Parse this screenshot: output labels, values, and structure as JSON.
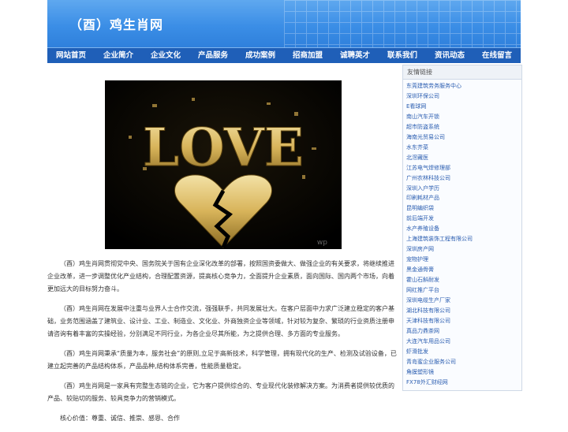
{
  "header": {
    "title": "（酉）鸡生肖网"
  },
  "nav": [
    "网站首页",
    "企业简介",
    "企业文化",
    "产品服务",
    "成功案例",
    "招商加盟",
    "诚聘英才",
    "联系我们",
    "资讯动态",
    "在线留言"
  ],
  "banner": {
    "word": "LOVE",
    "watermark": "wp"
  },
  "article": {
    "paragraphs": [
      "（酉）鸡生肖网贯彻党中央、国务院关于国有企业深化改革的部署，按照国资委做大、做强企业的有关要求，将继续推进企业改革，进一步调整优化产业结构，合理配置资源，提高核心竞争力，全面提升企业素质，面向国际、国内两个市场，向着更加远大的目标努力奋斗。",
      "（酉）鸡生肖网在发展中注重与业界人士合作交流，强强联手，共同发展壮大。在客户层面中力求广泛建立稳定的客户基础，业务范围涵盖了建筑业、设计业、工业、制造业、文化业、外商独资企业等领域，针对较为复杂、繁琐的行业资质注册申请咨询有着丰富的实操经验，分别满足不同行业，为各企业尽其所能，为之提供合理、多方面的专业服务。",
      "（酉）鸡生肖网秉承“质量为本，服务社会”的原则,立足于高新技术，科学管理，拥有现代化的生产、检测及试验设备，已建立起完善的产品结构体系，产品品种,结构体系完善，性能质量稳定。",
      "（酉）鸡生肖网是一家具有完整生态链的企业，它为客户提供综合的、专业现代化装修解决方案。为消费者提供较优质的产品、较贴切的服务、较具竞争力的营销模式。",
      "核心价值：尊重、诚信、推崇、感恩、合作"
    ]
  },
  "sidebar": {
    "title": "友情链接",
    "links": [
      "东莞建筑劳务服务中心",
      "深圳环保公司",
      "E看球网",
      "南山汽车开锁",
      "超市防盗系统",
      "海南光贸易公司",
      "水东芥菜",
      "北滘藏医",
      "江苏电气焊修理部",
      "广州农林科技公司",
      "深圳入户学历",
      "印刷耗材产品",
      "昆明编织袋",
      "前后端开发",
      "水产养殖设备",
      "上海建筑装饰工程有限公司",
      "深圳房产网",
      "宠物护理",
      "黑金通骨膏",
      "霍山石斛耐发",
      "网红推广平台",
      "深圳电缆生产厂家",
      "湖北科技有限公司",
      "天津科技有限公司",
      "真品力鼎茶网",
      "大连汽车用品公司",
      "虾滑批发",
      "青岛蜜企业服务公司",
      "角膜塑形镜",
      "FX78外汇财经网"
    ]
  }
}
